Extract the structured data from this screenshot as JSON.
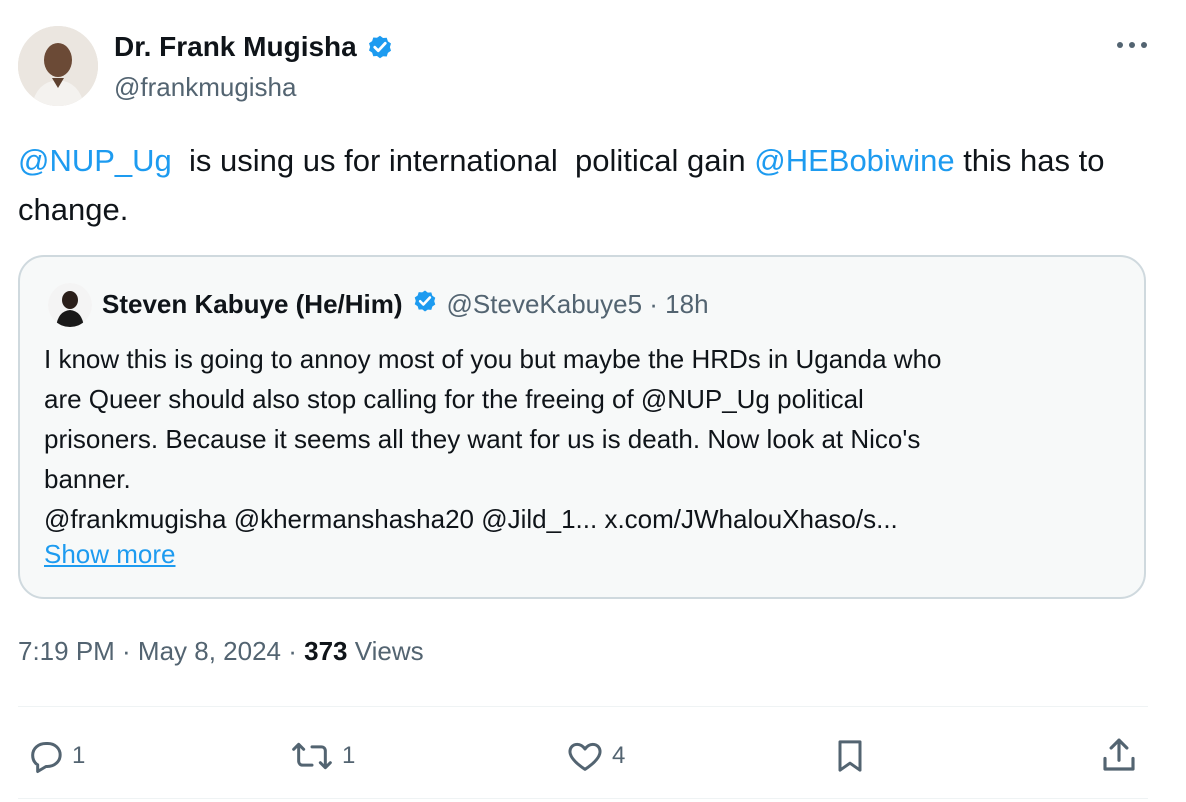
{
  "author": {
    "name": "Dr. Frank Mugisha",
    "handle": "@frankmugisha"
  },
  "tweet": {
    "mention1": "@NUP_Ug",
    "text1": "  is using us for international  political gain ",
    "mention2": "@HEBobiwine",
    "text2": " this has to change."
  },
  "quote": {
    "name": "Steven Kabuye (He/Him)",
    "handle_time": "@SteveKabuye5 · 18h",
    "body_lines": [
      "I know this is going to annoy most of you but maybe the HRDs in Uganda who",
      "are Queer  should also stop calling for the freeing of @NUP_Ug political",
      "prisoners. Because it seems all they want for us is death. Now look at Nico's",
      "banner.",
      "@frankmugisha @khermanshasha20 @Jild_1... x.com/JWhalouXhaso/s..."
    ],
    "show_more": "Show more"
  },
  "meta": {
    "time_date": "7:19 PM · May 8, 2024 · ",
    "views_count": "373",
    "views_label": " Views"
  },
  "actions": {
    "replies": "1",
    "reposts": "1",
    "likes": "4"
  },
  "colors": {
    "link": "#1d9bf0",
    "secondary": "#536471",
    "border": "#cfd9de"
  }
}
